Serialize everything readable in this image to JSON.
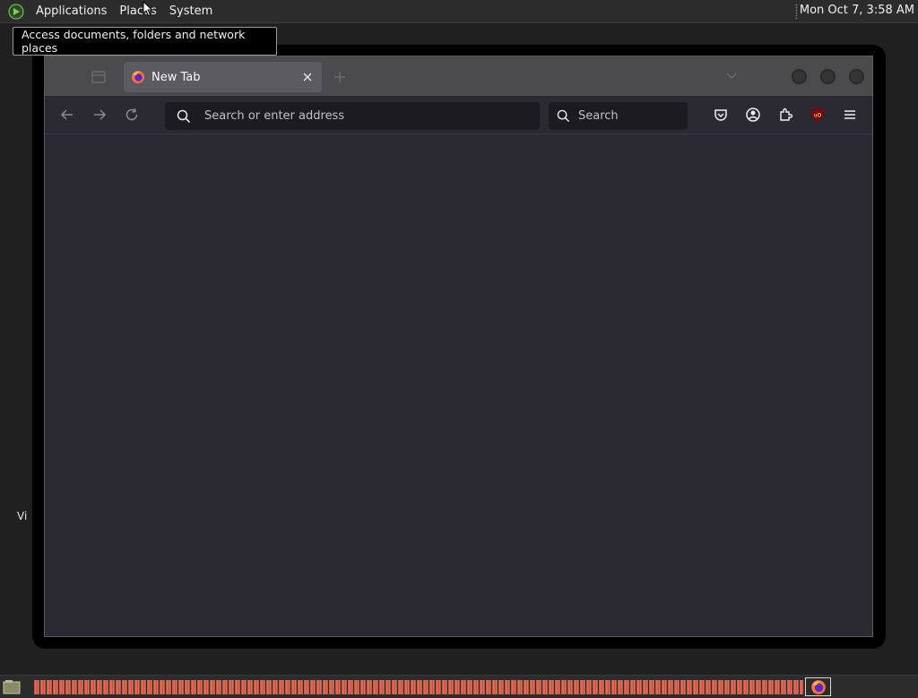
{
  "top_panel": {
    "menus": [
      "Applications",
      "Places",
      "System"
    ],
    "clock": "Mon Oct  7,  3:58 AM"
  },
  "tooltip": {
    "text": "Access documents, folders and network places"
  },
  "desktop": {
    "label": "Vi"
  },
  "browser": {
    "tab": {
      "title": "New Tab"
    },
    "urlbar": {
      "placeholder": "Search or enter address"
    },
    "searchbar": {
      "placeholder": "Search"
    }
  },
  "colors": {
    "panel": "#2c2c2c",
    "browser_bg": "#2b2a33",
    "tabbar": "#4a4a4f",
    "tab_active": "#5b5b61",
    "field_bg": "#1c1b22"
  },
  "icons": [
    "panel-app-icon",
    "tab-list-icon",
    "firefox-icon",
    "close-icon",
    "plus-icon",
    "chevron-down-icon",
    "back-arrow-icon",
    "forward-arrow-icon",
    "reload-icon",
    "search-icon",
    "pocket-icon",
    "account-icon",
    "extensions-icon",
    "ublock-icon",
    "hamburger-menu-icon",
    "show-desktop-icon"
  ]
}
